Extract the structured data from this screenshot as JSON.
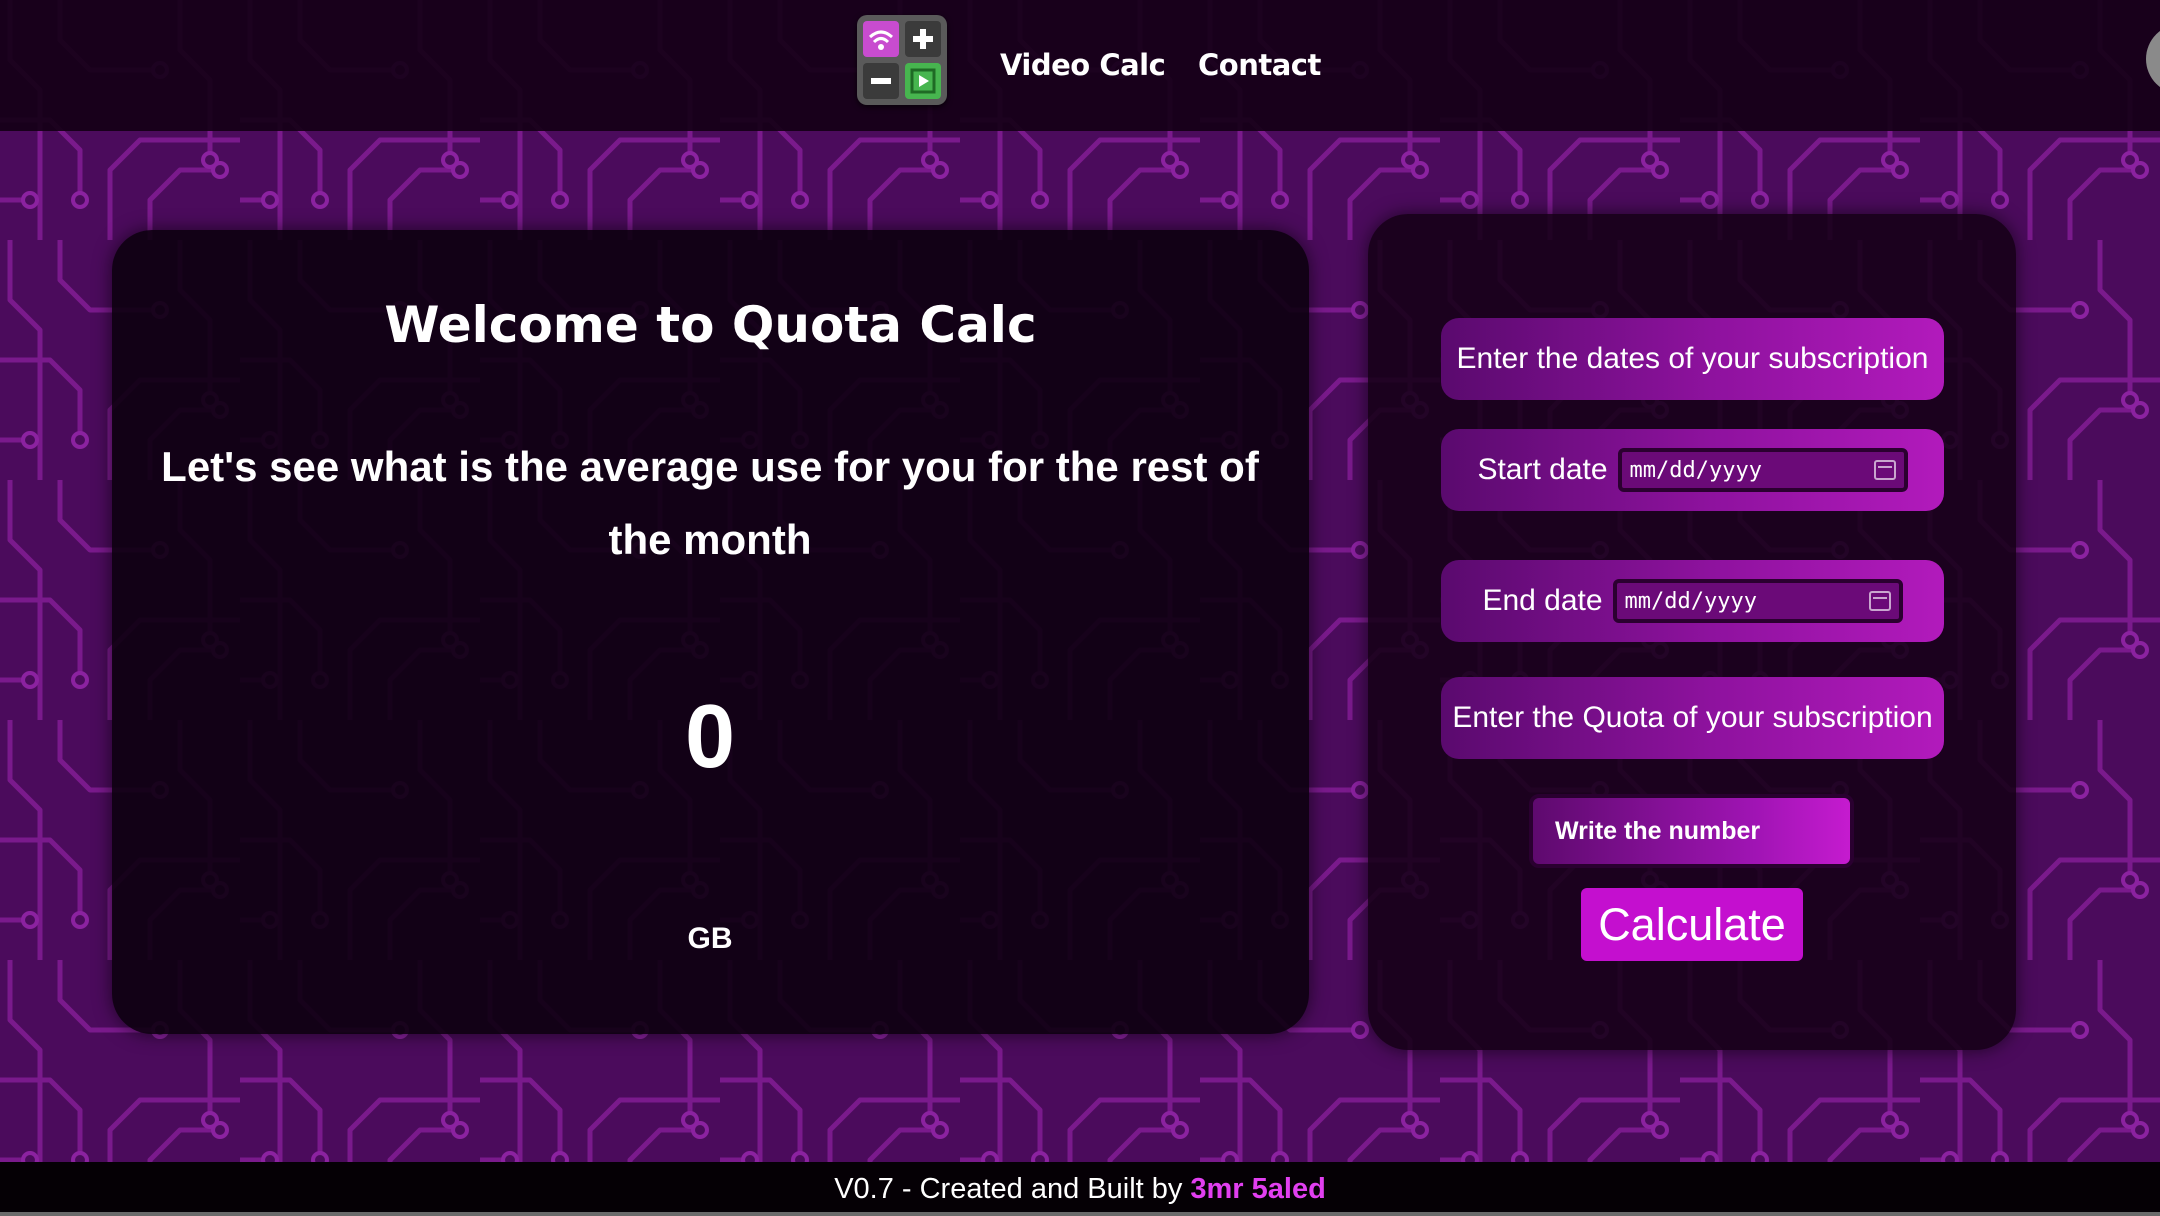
{
  "nav": {
    "logo_icon": "quota-calc-logo-icon",
    "links": [
      "Video Calc",
      "Contact"
    ]
  },
  "main": {
    "title": "Welcome to Quota Calc",
    "subtitle": "Let's see what is the average use for you for the rest of the month",
    "result_value": "0",
    "result_unit": "GB"
  },
  "form": {
    "dates_prompt": "Enter the dates of your subscription",
    "start_label": "Start date",
    "start_placeholder": "mm/dd/yyyy",
    "end_label": "End date",
    "end_placeholder": "mm/dd/yyyy",
    "quota_prompt": "Enter the Quota of your subscription",
    "quota_placeholder": "Write the number",
    "calculate_label": "Calculate"
  },
  "footer": {
    "text": "V0.7 - Created and Built by",
    "author": "3mr 5aled"
  },
  "colors": {
    "accent": "#c40fcf",
    "background": "#4a0a5a",
    "author": "#e13ff0"
  }
}
